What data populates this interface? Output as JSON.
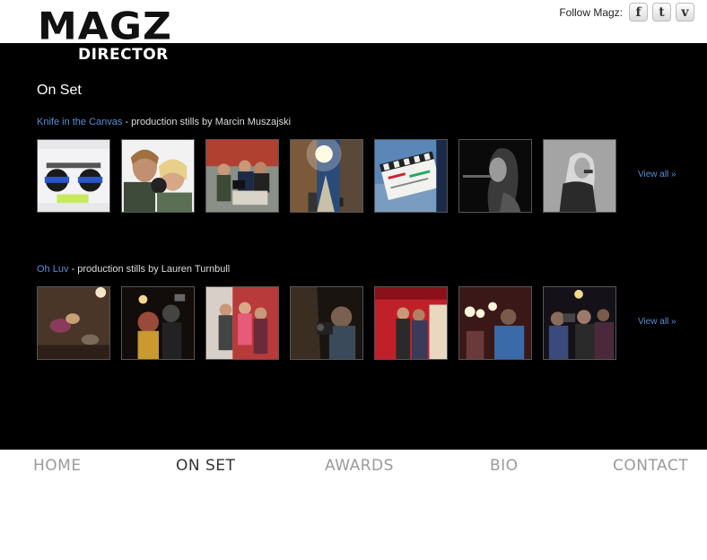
{
  "brand": {
    "logo_line1": "MAGZ",
    "logo_line2": "DIRECTOR"
  },
  "social": {
    "label": "Follow Magz:",
    "icons": [
      "facebook-icon",
      "twitter-icon",
      "vimeo-icon"
    ],
    "glyphs": [
      "f",
      "t",
      "v"
    ]
  },
  "page": {
    "title": "On Set"
  },
  "galleries": [
    {
      "title": "Knife in the Canvas",
      "subtitle": " - production stills by Marcin Muszajski",
      "view_all": "View all »",
      "thumbnails": [
        "panavision-camera-photo",
        "crew-with-camera-photo",
        "film-set-street-photo",
        "sunlit-street-photo",
        "clapperboard-photo",
        "woman-silhouette-photo",
        "woman-on-phone-photo"
      ]
    },
    {
      "title": "Oh Luv",
      "subtitle": " - production stills by Lauren Turnbull",
      "view_all": "View all »",
      "thumbnails": [
        "dancers-overhead-photo",
        "party-crowd-photo",
        "red-room-dancers-photo",
        "cameraman-photo",
        "red-curtain-couple-photo",
        "camera-crew-lights-photo",
        "stage-crowd-photo"
      ]
    }
  ],
  "nav": {
    "items": [
      "HOME",
      "ON SET",
      "AWARDS",
      "BIO",
      "CONTACT"
    ],
    "active": "ON SET"
  },
  "colors": {
    "background_main": "#000000",
    "link": "#5a8ed8",
    "nav_inactive": "#9a9a9a",
    "nav_active": "#333333"
  }
}
